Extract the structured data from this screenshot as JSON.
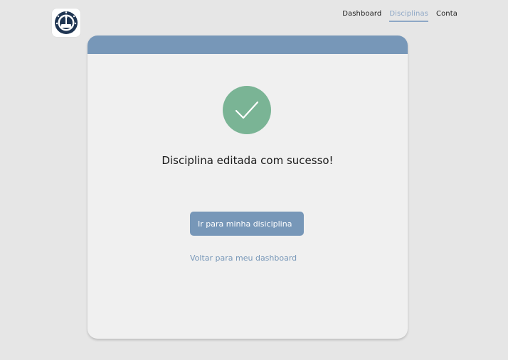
{
  "header": {
    "logo_icon": "school-crest-logo"
  },
  "nav": {
    "items": [
      {
        "label": "Dashboard",
        "active": false
      },
      {
        "label": "Disciplinas",
        "active": true
      },
      {
        "label": "Conta",
        "active": false
      }
    ]
  },
  "card": {
    "success_icon": "checkmark-icon",
    "message": "Disciplina editada com sucesso!",
    "primary_button_label": "Ir para minha disiciplina",
    "back_link_label": "Voltar para meu dashboard"
  },
  "colors": {
    "accent": "#7797b8",
    "success": "#7ab495",
    "background": "#e6e6e6",
    "card": "#f0f0f0"
  }
}
